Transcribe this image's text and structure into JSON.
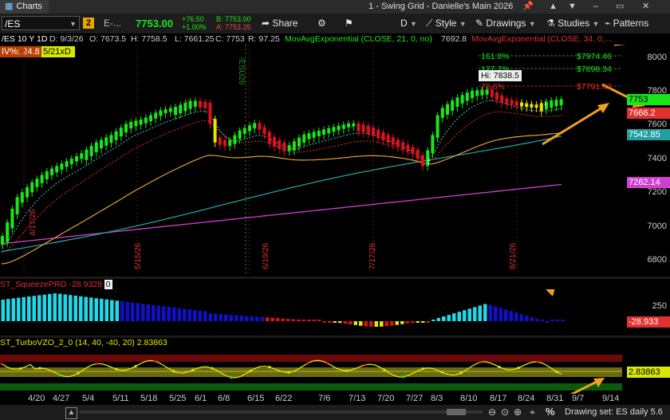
{
  "titlebar": {
    "app_tab": "Charts",
    "window_title": "1 - Swing Grid - Danielle's Main 2026"
  },
  "toolbar": {
    "symbol": "/ES",
    "desc": "E-...",
    "last": "7753.00",
    "change": "+76.50",
    "change_pct": "+1.00%",
    "bid": "B: 7753.00",
    "ask": "A: 7753.25",
    "share": "Share",
    "period": "D",
    "style": "Style",
    "drawings": "Drawings",
    "studies": "Studies",
    "patterns": "Patterns",
    "link_num": "2"
  },
  "infobar": {
    "title": "/ES 10 Y 1D",
    "date": "D: 9/3/26",
    "open": "O: 7673.5",
    "high": "H: 7758.5",
    "low": "L: 7661.25",
    "close": "C: 7753",
    "range": "R: 97.25",
    "ema21": "MovAvgExponential (CLOSE, 21, 0, no)",
    "ema21_val": "7692.8",
    "ema34": "MovAvgExponential (CLOSE, 34, 0,..."
  },
  "iv": {
    "label": "IV%: 24.8",
    "badge": "5/21xD"
  },
  "fib": {
    "l1": "161.8%",
    "v1": "$7974.46",
    "l2": "127.2%",
    "v2": "$7898.34",
    "l3": "78.6%",
    "v3": "$7791.42",
    "hi": "Hi: 7838.5"
  },
  "price_axis": [
    "8000",
    "7800",
    "7600",
    "7400",
    "7200",
    "7000",
    "6800"
  ],
  "price_boxes": {
    "last": "7753",
    "ema_red": "7666.2",
    "ema_teal": "7542.85",
    "ema_pink": "7262.14"
  },
  "vlines": [
    "/ESU26",
    "4/17/26",
    "5/15/26",
    "6/19/26",
    "7/17/26",
    "8/21/26"
  ],
  "squeeze": {
    "name": "ST_SqueezePRO",
    "value": "-28.9328",
    "extra": "0",
    "axis": "250",
    "box": "-28.933"
  },
  "turbo": {
    "name": "ST_TurboVZO_2_0 (14, 40, -40, 20)",
    "value": "2.83863",
    "box": "2.83863"
  },
  "xaxis": [
    "4/20",
    "4/27",
    "5/4",
    "5/11",
    "5/18",
    "5/25",
    "6/1",
    "6/8",
    "6/15",
    "6/22",
    "7/6",
    "7/13",
    "7/20",
    "7/27",
    "8/3",
    "8/10",
    "8/17",
    "8/24",
    "8/31",
    "9/7",
    "9/14"
  ],
  "status": {
    "drawing_set": "Drawing set: ES daily 5.6"
  },
  "colors": {
    "up": "#19e619",
    "down": "#e01020",
    "ema_red": "#e03030",
    "ema_teal": "#20a0a0",
    "ema_orange": "#e0a030",
    "ema_pink": "#d040d0",
    "annot": "#f0a020"
  }
}
